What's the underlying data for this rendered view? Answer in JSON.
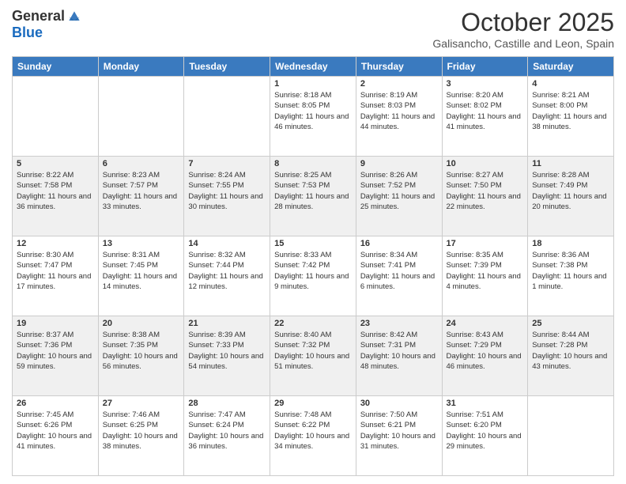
{
  "header": {
    "logo_general": "General",
    "logo_blue": "Blue",
    "month": "October 2025",
    "location": "Galisancho, Castille and Leon, Spain"
  },
  "weekdays": [
    "Sunday",
    "Monday",
    "Tuesday",
    "Wednesday",
    "Thursday",
    "Friday",
    "Saturday"
  ],
  "weeks": [
    [
      {
        "day": "",
        "info": ""
      },
      {
        "day": "",
        "info": ""
      },
      {
        "day": "",
        "info": ""
      },
      {
        "day": "1",
        "info": "Sunrise: 8:18 AM\nSunset: 8:05 PM\nDaylight: 11 hours and 46 minutes."
      },
      {
        "day": "2",
        "info": "Sunrise: 8:19 AM\nSunset: 8:03 PM\nDaylight: 11 hours and 44 minutes."
      },
      {
        "day": "3",
        "info": "Sunrise: 8:20 AM\nSunset: 8:02 PM\nDaylight: 11 hours and 41 minutes."
      },
      {
        "day": "4",
        "info": "Sunrise: 8:21 AM\nSunset: 8:00 PM\nDaylight: 11 hours and 38 minutes."
      }
    ],
    [
      {
        "day": "5",
        "info": "Sunrise: 8:22 AM\nSunset: 7:58 PM\nDaylight: 11 hours and 36 minutes."
      },
      {
        "day": "6",
        "info": "Sunrise: 8:23 AM\nSunset: 7:57 PM\nDaylight: 11 hours and 33 minutes."
      },
      {
        "day": "7",
        "info": "Sunrise: 8:24 AM\nSunset: 7:55 PM\nDaylight: 11 hours and 30 minutes."
      },
      {
        "day": "8",
        "info": "Sunrise: 8:25 AM\nSunset: 7:53 PM\nDaylight: 11 hours and 28 minutes."
      },
      {
        "day": "9",
        "info": "Sunrise: 8:26 AM\nSunset: 7:52 PM\nDaylight: 11 hours and 25 minutes."
      },
      {
        "day": "10",
        "info": "Sunrise: 8:27 AM\nSunset: 7:50 PM\nDaylight: 11 hours and 22 minutes."
      },
      {
        "day": "11",
        "info": "Sunrise: 8:28 AM\nSunset: 7:49 PM\nDaylight: 11 hours and 20 minutes."
      }
    ],
    [
      {
        "day": "12",
        "info": "Sunrise: 8:30 AM\nSunset: 7:47 PM\nDaylight: 11 hours and 17 minutes."
      },
      {
        "day": "13",
        "info": "Sunrise: 8:31 AM\nSunset: 7:45 PM\nDaylight: 11 hours and 14 minutes."
      },
      {
        "day": "14",
        "info": "Sunrise: 8:32 AM\nSunset: 7:44 PM\nDaylight: 11 hours and 12 minutes."
      },
      {
        "day": "15",
        "info": "Sunrise: 8:33 AM\nSunset: 7:42 PM\nDaylight: 11 hours and 9 minutes."
      },
      {
        "day": "16",
        "info": "Sunrise: 8:34 AM\nSunset: 7:41 PM\nDaylight: 11 hours and 6 minutes."
      },
      {
        "day": "17",
        "info": "Sunrise: 8:35 AM\nSunset: 7:39 PM\nDaylight: 11 hours and 4 minutes."
      },
      {
        "day": "18",
        "info": "Sunrise: 8:36 AM\nSunset: 7:38 PM\nDaylight: 11 hours and 1 minute."
      }
    ],
    [
      {
        "day": "19",
        "info": "Sunrise: 8:37 AM\nSunset: 7:36 PM\nDaylight: 10 hours and 59 minutes."
      },
      {
        "day": "20",
        "info": "Sunrise: 8:38 AM\nSunset: 7:35 PM\nDaylight: 10 hours and 56 minutes."
      },
      {
        "day": "21",
        "info": "Sunrise: 8:39 AM\nSunset: 7:33 PM\nDaylight: 10 hours and 54 minutes."
      },
      {
        "day": "22",
        "info": "Sunrise: 8:40 AM\nSunset: 7:32 PM\nDaylight: 10 hours and 51 minutes."
      },
      {
        "day": "23",
        "info": "Sunrise: 8:42 AM\nSunset: 7:31 PM\nDaylight: 10 hours and 48 minutes."
      },
      {
        "day": "24",
        "info": "Sunrise: 8:43 AM\nSunset: 7:29 PM\nDaylight: 10 hours and 46 minutes."
      },
      {
        "day": "25",
        "info": "Sunrise: 8:44 AM\nSunset: 7:28 PM\nDaylight: 10 hours and 43 minutes."
      }
    ],
    [
      {
        "day": "26",
        "info": "Sunrise: 7:45 AM\nSunset: 6:26 PM\nDaylight: 10 hours and 41 minutes."
      },
      {
        "day": "27",
        "info": "Sunrise: 7:46 AM\nSunset: 6:25 PM\nDaylight: 10 hours and 38 minutes."
      },
      {
        "day": "28",
        "info": "Sunrise: 7:47 AM\nSunset: 6:24 PM\nDaylight: 10 hours and 36 minutes."
      },
      {
        "day": "29",
        "info": "Sunrise: 7:48 AM\nSunset: 6:22 PM\nDaylight: 10 hours and 34 minutes."
      },
      {
        "day": "30",
        "info": "Sunrise: 7:50 AM\nSunset: 6:21 PM\nDaylight: 10 hours and 31 minutes."
      },
      {
        "day": "31",
        "info": "Sunrise: 7:51 AM\nSunset: 6:20 PM\nDaylight: 10 hours and 29 minutes."
      },
      {
        "day": "",
        "info": ""
      }
    ]
  ]
}
